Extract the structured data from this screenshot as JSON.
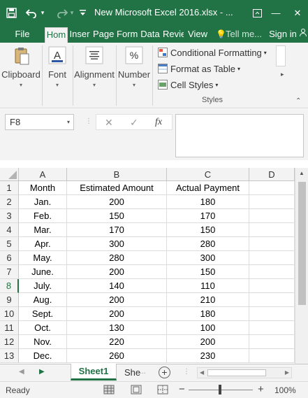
{
  "title_bar": {
    "title": "New Microsoft Excel 2016.xlsx - ...",
    "save_icon": "save-icon",
    "undo_icon": "undo-icon",
    "redo_icon": "redo-icon",
    "ribbon_options_icon": "ribbon-display-options-icon",
    "minimize_glyph": "—",
    "close_glyph": "✕"
  },
  "ribbon_tabs": {
    "file": "File",
    "home": "Hom",
    "insert": "Inser",
    "page": "Page",
    "formulas": "Form",
    "data": "Data",
    "review": "Revie",
    "view": "View",
    "tell_me": "Tell me...",
    "sign_in": "Sign in"
  },
  "ribbon": {
    "clipboard": "Clipboard",
    "font": "Font",
    "alignment": "Alignment",
    "number": "Number",
    "conditional_formatting": "Conditional Formatting",
    "format_as_table": "Format as Table",
    "cell_styles": "Cell Styles",
    "styles_group": "Styles",
    "dropdown_glyph": "▾"
  },
  "formula_bar": {
    "name_box": "F8",
    "cancel_glyph": "✕",
    "enter_glyph": "✓",
    "fx_glyph": "fx",
    "formula": ""
  },
  "sheet": {
    "columns": [
      "A",
      "B",
      "C",
      "D"
    ],
    "rows": [
      {
        "n": "1",
        "a": "Month",
        "b": "Estimated Amount",
        "c": "Actual Payment"
      },
      {
        "n": "2",
        "a": "Jan.",
        "b": "200",
        "c": "180"
      },
      {
        "n": "3",
        "a": "Feb.",
        "b": "150",
        "c": "170"
      },
      {
        "n": "4",
        "a": "Mar.",
        "b": "170",
        "c": "150"
      },
      {
        "n": "5",
        "a": "Apr.",
        "b": "300",
        "c": "280"
      },
      {
        "n": "6",
        "a": "May.",
        "b": "280",
        "c": "300"
      },
      {
        "n": "7",
        "a": "June.",
        "b": "200",
        "c": "150"
      },
      {
        "n": "8",
        "a": "July.",
        "b": "140",
        "c": "110"
      },
      {
        "n": "9",
        "a": "Aug.",
        "b": "200",
        "c": "210"
      },
      {
        "n": "10",
        "a": "Sept.",
        "b": "200",
        "c": "180"
      },
      {
        "n": "11",
        "a": "Oct.",
        "b": "130",
        "c": "100"
      },
      {
        "n": "12",
        "a": "Nov.",
        "b": "220",
        "c": "200"
      },
      {
        "n": "13",
        "a": "Dec.",
        "b": "260",
        "c": "230"
      }
    ],
    "selected_row": "8"
  },
  "sheet_tabs": {
    "active": "Sheet1",
    "other": "She",
    "add_glyph": "+",
    "prev_glyph": "◀",
    "next_glyph": "▶"
  },
  "status_bar": {
    "ready": "Ready",
    "zoom": "100%",
    "zoom_minus": "−",
    "zoom_plus": "+"
  },
  "colors": {
    "accent": "#217346",
    "ribbon_bg": "#f3f3f3"
  }
}
